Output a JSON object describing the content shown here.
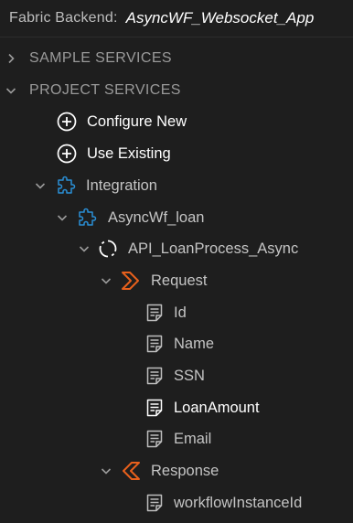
{
  "header": {
    "label": "Fabric Backend:",
    "app_name": "AsyncWF_Websocket_App"
  },
  "tree": {
    "sample_services": {
      "label": "SAMPLE SERVICES",
      "state": "collapsed"
    },
    "project_services": {
      "label": "PROJECT SERVICES",
      "state": "expanded"
    },
    "configure_new": {
      "label": "Configure New",
      "icon": "plus-circle-icon"
    },
    "use_existing": {
      "label": "Use Existing",
      "icon": "plus-circle-icon"
    },
    "integration": {
      "label": "Integration",
      "icon": "puzzle-icon"
    },
    "service": {
      "label": "AsyncWf_loan",
      "icon": "puzzle-icon"
    },
    "operation": {
      "label": "API_LoanProcess_Async",
      "icon": "sync-icon"
    },
    "request": {
      "label": "Request",
      "icon": "request-chevron-icon",
      "fields": [
        {
          "label": "Id"
        },
        {
          "label": "Name"
        },
        {
          "label": "SSN"
        },
        {
          "label": "LoanAmount",
          "selected": true
        },
        {
          "label": "Email"
        }
      ]
    },
    "response": {
      "label": "Response",
      "icon": "response-chevron-icon",
      "fields": [
        {
          "label": "workflowInstanceId"
        }
      ]
    }
  },
  "colors": {
    "background": "#1e1e1e",
    "text": "#c4c4c4",
    "section_text": "#9a9a9a",
    "accent_blue": "#2a8fd6",
    "accent_orange": "#e8601c"
  }
}
